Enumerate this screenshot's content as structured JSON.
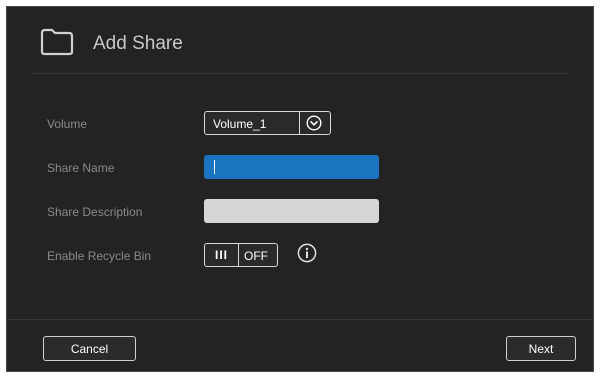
{
  "dialog": {
    "title": "Add Share",
    "title_icon": "folder-icon"
  },
  "form": {
    "volume": {
      "label": "Volume",
      "selected": "Volume_1",
      "dropdown_icon": "chevron-down-icon"
    },
    "share_name": {
      "label": "Share Name",
      "value": ""
    },
    "share_description": {
      "label": "Share Description",
      "value": ""
    },
    "recycle_bin": {
      "label": "Enable Recycle Bin",
      "knob_label": "III",
      "state_label": "OFF",
      "enabled": false,
      "info_icon": "info-icon"
    }
  },
  "footer": {
    "cancel_label": "Cancel",
    "next_label": "Next"
  },
  "colors": {
    "background": "#232323",
    "active_input": "#1b74c0",
    "inactive_input": "#d6d6d6",
    "label_text": "#8a8a8a",
    "title_text": "#c8c8c8"
  }
}
